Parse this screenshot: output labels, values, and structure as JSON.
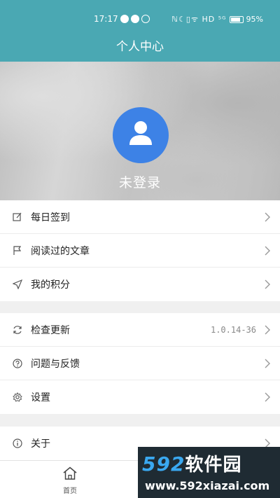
{
  "status_bar": {
    "time": "17:17",
    "system_icons": "ℕ☾▯ᯤ HD ⁵ᴳ",
    "battery": "95%"
  },
  "header": {
    "title": "个人中心"
  },
  "profile": {
    "login_text": "未登录"
  },
  "groups": [
    [
      {
        "label": "每日签到",
        "icon": "edit-icon"
      },
      {
        "label": "阅读过的文章",
        "icon": "flag-icon"
      },
      {
        "label": "我的积分",
        "icon": "send-icon"
      }
    ],
    [
      {
        "label": "检查更新",
        "icon": "refresh-icon",
        "value": "1.0.14-36"
      },
      {
        "label": "问题与反馈",
        "icon": "question-icon"
      },
      {
        "label": "设置",
        "icon": "gear-icon"
      }
    ],
    [
      {
        "label": "关于",
        "icon": "info-icon"
      }
    ]
  ],
  "bottom_nav": {
    "home_label": "首页"
  },
  "watermark": {
    "top_digits": "592",
    "top_text": "软件园",
    "bottom": "www.592xiazai.com"
  },
  "colors": {
    "header": "#4aa8b3",
    "avatar": "#3d82e6"
  }
}
